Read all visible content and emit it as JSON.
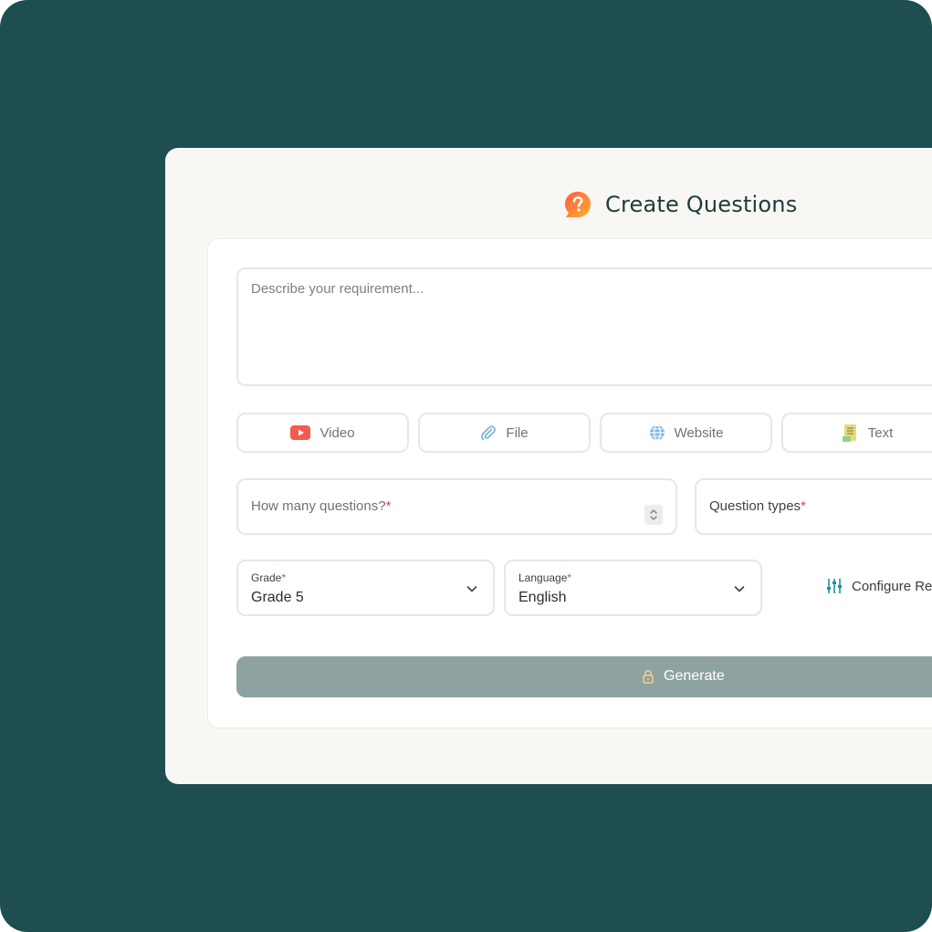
{
  "header": {
    "title": "Create Questions",
    "logo_icon": "question-bubble-icon"
  },
  "requirement": {
    "placeholder": "Describe your requirement..."
  },
  "sources": [
    {
      "label": "Video",
      "icon": "youtube-icon"
    },
    {
      "label": "File",
      "icon": "paperclip-icon"
    },
    {
      "label": "Website",
      "icon": "globe-icon"
    },
    {
      "label": "Text",
      "icon": "text-document-icon"
    }
  ],
  "questions_count": {
    "placeholder": "How many questions?",
    "required_mark": "*"
  },
  "question_types": {
    "placeholder": "Question types",
    "required_mark": "*"
  },
  "grade": {
    "label": "Grade",
    "required_mark": "*",
    "value": "Grade 5"
  },
  "language": {
    "label": "Language",
    "required_mark": "*",
    "value": "English"
  },
  "configure": {
    "label": "Configure Re",
    "icon": "sliders-icon"
  },
  "generate": {
    "label": "Generate",
    "icon": "lock-icon"
  },
  "colors": {
    "background": "#1f4e50",
    "panel": "#f8f7f3",
    "generate_button": "#8fa2a2",
    "required": "#e0445a",
    "accent_teal": "#1a8fa0"
  }
}
